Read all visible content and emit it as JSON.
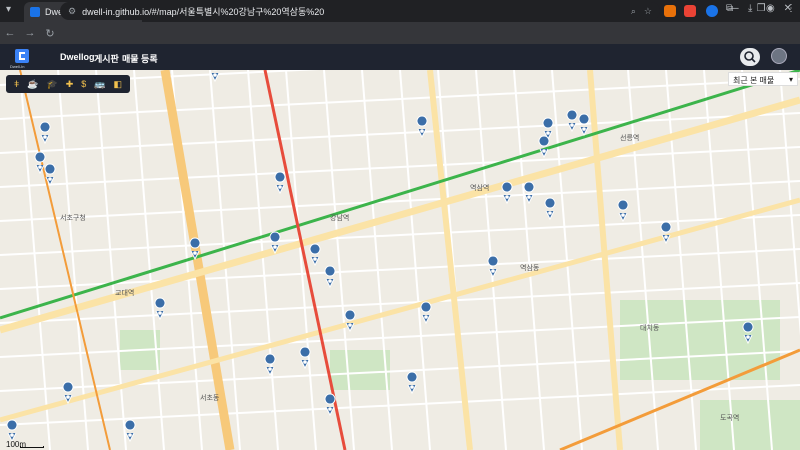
{
  "browser": {
    "tab_title": "Dwell-In",
    "new_tab": "+",
    "url": "dwell-in.github.io/#/map/서울특별시%20강남구%20역삼동%20",
    "controls": [
      "—",
      "❐",
      "✕"
    ]
  },
  "app": {
    "logo_text": "Dwell-In",
    "nav": [
      "Dwellog",
      "게시판",
      "매물 등록"
    ]
  },
  "map": {
    "sort_select": "최근 본 매물",
    "scale_label": "100m",
    "tool_icons": [
      "fork-knife-icon",
      "cafe-icon",
      "school-icon",
      "hospital-icon",
      "dollar-icon",
      "bus-icon",
      "layers-icon"
    ],
    "tool_glyphs": [
      "ǂ",
      "☕",
      "🎓",
      "✚",
      "$",
      "🚌",
      "◧"
    ],
    "labels": [
      "교대역",
      "강남역",
      "역삼역",
      "선릉역",
      "서초동",
      "역삼동",
      "대치동",
      "서초구청",
      "도곡역"
    ],
    "colors": {
      "green_line": "#3cb44b",
      "orange_line": "#f39c3a",
      "red_line": "#e74c3c",
      "pin": "#3b6ea8"
    }
  }
}
